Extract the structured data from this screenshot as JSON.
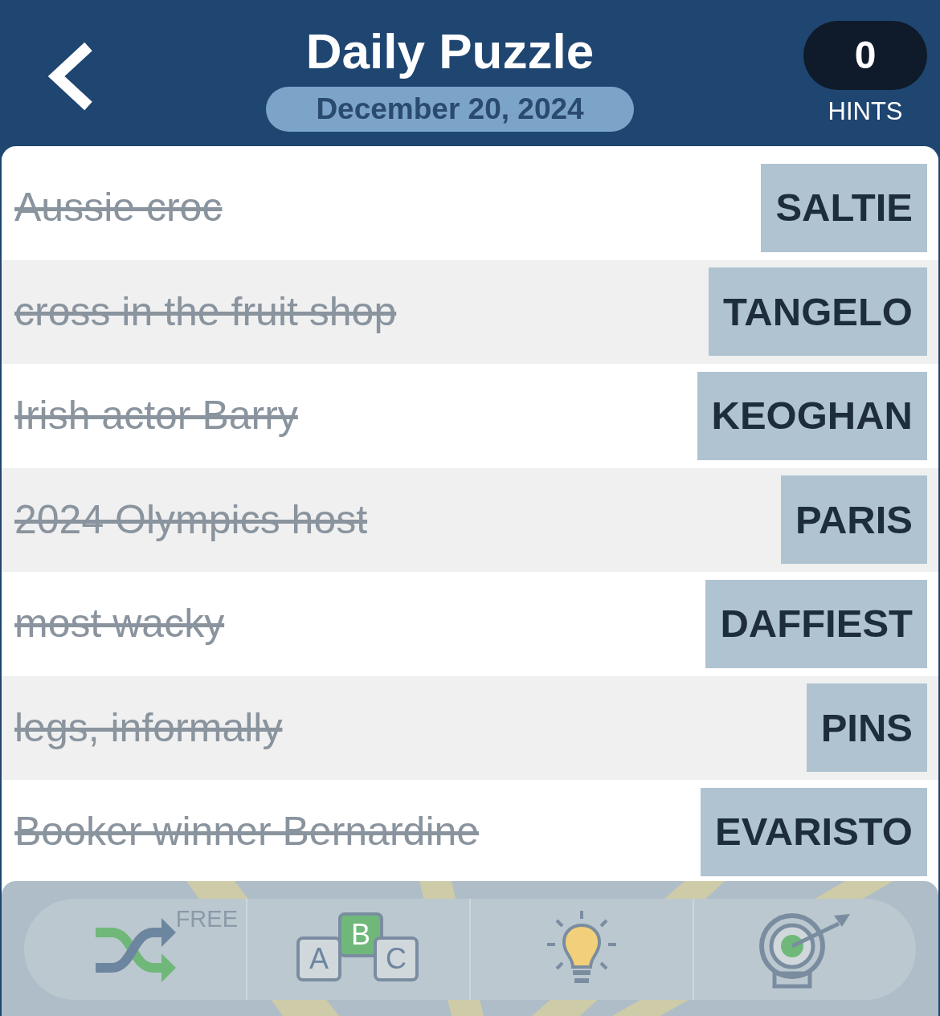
{
  "header": {
    "title": "Daily Puzzle",
    "date": "December 20, 2024",
    "hints": {
      "count": "0",
      "label": "HINTS"
    }
  },
  "clues": [
    {
      "clue": "Aussie croc",
      "answer": "SALTIE",
      "solved": true
    },
    {
      "clue": "cross in the fruit shop",
      "answer": "TANGELO",
      "solved": true
    },
    {
      "clue": "Irish actor Barry",
      "answer": "KEOGHAN",
      "solved": true
    },
    {
      "clue": "2024 Olympics host",
      "answer": "PARIS",
      "solved": true
    },
    {
      "clue": "most wacky",
      "answer": "DAFFIEST",
      "solved": true
    },
    {
      "clue": "legs, informally",
      "answer": "PINS",
      "solved": true
    },
    {
      "clue": "Booker winner Bernardine",
      "answer": "EVARISTO",
      "solved": true
    }
  ],
  "toolbar": [
    {
      "kind": "shuffle",
      "badge": "FREE"
    },
    {
      "kind": "letters",
      "letters": [
        "A",
        "B",
        "C"
      ]
    },
    {
      "kind": "hint"
    },
    {
      "kind": "target"
    }
  ]
}
